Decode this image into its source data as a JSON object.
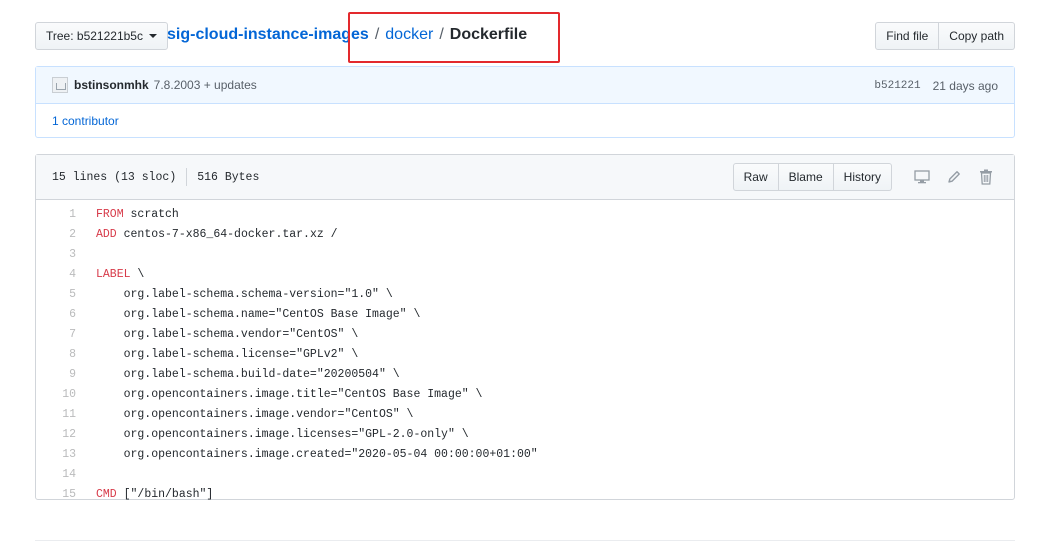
{
  "topbar": {
    "tree_label": "Tree: b521221b5c",
    "breadcrumb": {
      "repo": "sig-cloud-instance-images",
      "sep1": "/",
      "folder": "docker",
      "sep2": "/",
      "file": "Dockerfile"
    },
    "find_file": "Find file",
    "copy_path": "Copy path"
  },
  "commit": {
    "author": "bstinsonmhk",
    "message": "7.8.2003 + updates",
    "sha": "b521221",
    "date": "21 days ago",
    "contributors": "1 contributor"
  },
  "file": {
    "lines_info": "15 lines (13 sloc)",
    "size": "516 Bytes",
    "raw": "Raw",
    "blame": "Blame",
    "history": "History",
    "icons": [
      "desktop-icon",
      "pencil-icon",
      "trash-icon"
    ]
  },
  "code": [
    {
      "n": "1",
      "kw": "FROM",
      "rest": " scratch"
    },
    {
      "n": "2",
      "kw": "ADD",
      "rest": " centos-7-x86_64-docker.tar.xz /"
    },
    {
      "n": "3",
      "kw": "",
      "rest": ""
    },
    {
      "n": "4",
      "kw": "LABEL",
      "rest": " \\"
    },
    {
      "n": "5",
      "kw": "",
      "rest": "    org.label-schema.schema-version=\"1.0\" \\"
    },
    {
      "n": "6",
      "kw": "",
      "rest": "    org.label-schema.name=\"CentOS Base Image\" \\"
    },
    {
      "n": "7",
      "kw": "",
      "rest": "    org.label-schema.vendor=\"CentOS\" \\"
    },
    {
      "n": "8",
      "kw": "",
      "rest": "    org.label-schema.license=\"GPLv2\" \\"
    },
    {
      "n": "9",
      "kw": "",
      "rest": "    org.label-schema.build-date=\"20200504\" \\"
    },
    {
      "n": "10",
      "kw": "",
      "rest": "    org.opencontainers.image.title=\"CentOS Base Image\" \\"
    },
    {
      "n": "11",
      "kw": "",
      "rest": "    org.opencontainers.image.vendor=\"CentOS\" \\"
    },
    {
      "n": "12",
      "kw": "",
      "rest": "    org.opencontainers.image.licenses=\"GPL-2.0-only\" \\"
    },
    {
      "n": "13",
      "kw": "",
      "rest": "    org.opencontainers.image.created=\"2020-05-04 00:00:00+01:00\""
    },
    {
      "n": "14",
      "kw": "",
      "rest": ""
    },
    {
      "n": "15",
      "kw": "CMD",
      "rest": " [\"/bin/bash\"]"
    }
  ],
  "colors": {
    "link": "#0366d6",
    "keyword": "#d73a49",
    "highlight_box": "#e3292d"
  }
}
